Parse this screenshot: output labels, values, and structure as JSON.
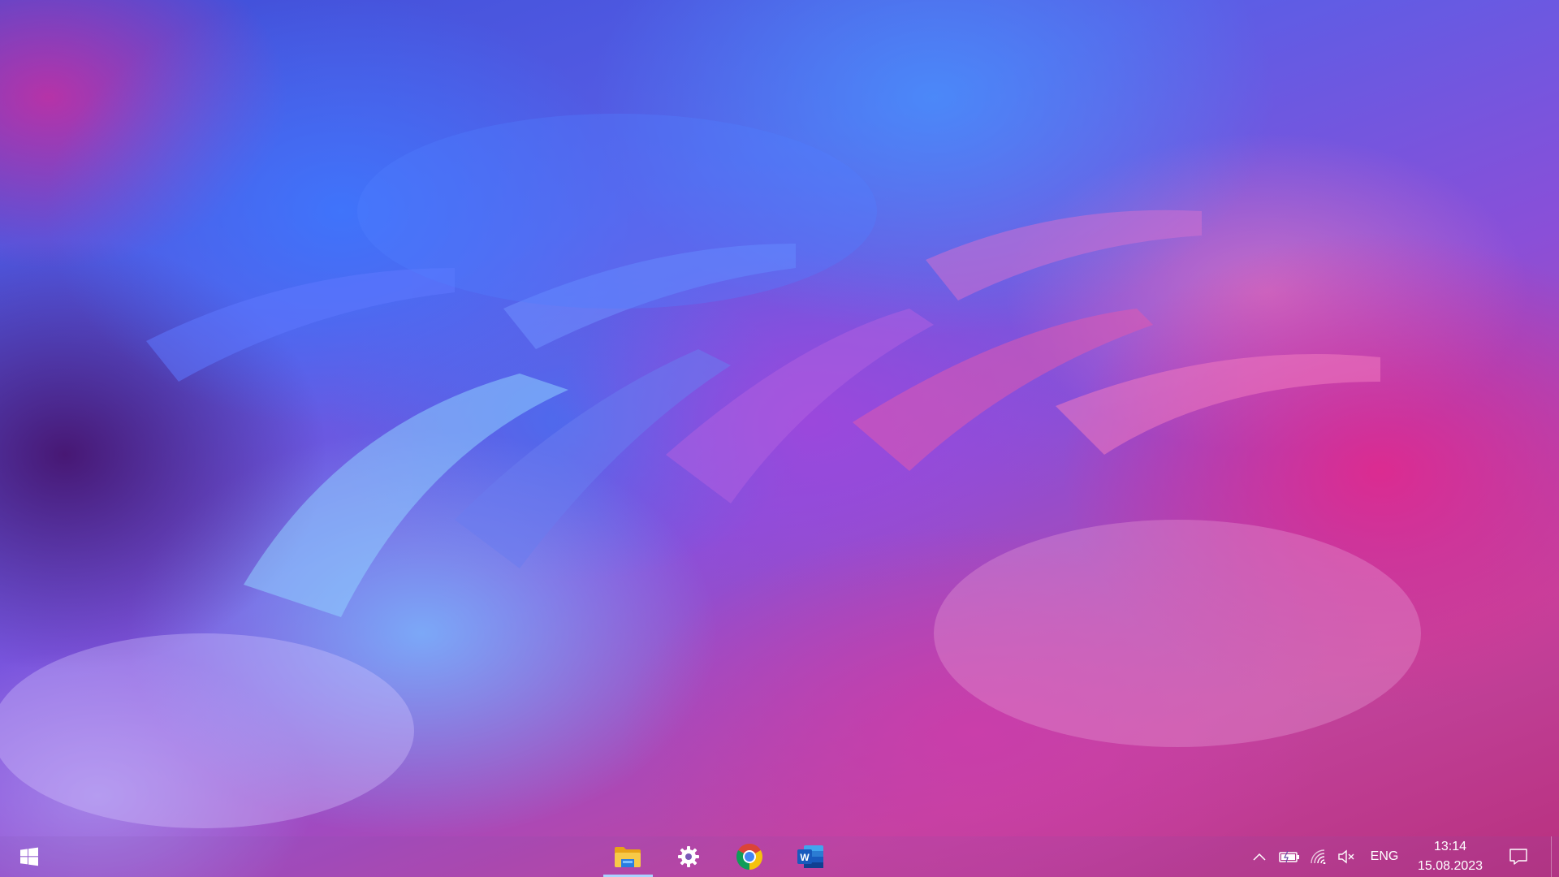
{
  "taskbar": {
    "start": {
      "icon": "windows-logo-icon",
      "color": "#ffffff"
    },
    "pinned_apps": [
      {
        "icon": "file-explorer-icon",
        "active": true
      },
      {
        "icon": "gear-icon",
        "active": false
      },
      {
        "icon": "chrome-icon",
        "active": false
      },
      {
        "icon": "word-icon",
        "active": false
      }
    ],
    "active_indicator_color": "#a9d4ff"
  },
  "tray": {
    "icons": [
      "chevron-up-icon",
      "battery-icon",
      "wifi-icon",
      "volume-muted-icon"
    ],
    "language": "ENG",
    "time": "13:14",
    "date": "15.08.2023",
    "notification_icon": "notification-icon"
  },
  "wallpaper": {
    "palette": [
      "#3d4fd8",
      "#5a5ee6",
      "#8a4fd8",
      "#c2449e",
      "#b8307e",
      "#78beff"
    ]
  }
}
